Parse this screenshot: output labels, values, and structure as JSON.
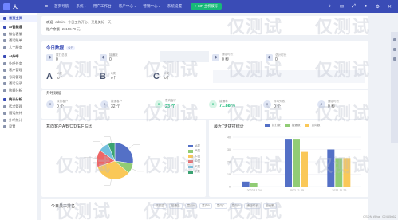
{
  "brand": {
    "name": "人"
  },
  "topnav": [
    {
      "label": "首页导航",
      "drop": false
    },
    {
      "label": "系统",
      "drop": true
    },
    {
      "label": "用户工作台",
      "drop": false
    },
    {
      "label": "客户中心",
      "drop": true
    },
    {
      "label": "营销中心",
      "drop": true
    },
    {
      "label": "系统设置",
      "drop": false
    }
  ],
  "sip_button": "+ SIP 主机拨号",
  "sidebar": [
    {
      "label": "首页主页",
      "type": "item",
      "active": true
    },
    {
      "label": "AI智能通",
      "type": "group"
    },
    {
      "label": "微信客服",
      "type": "item"
    },
    {
      "label": "通话账单",
      "type": "item"
    },
    {
      "label": "人工服务",
      "type": "item"
    },
    {
      "label": "AI外呼",
      "type": "group"
    },
    {
      "label": "外呼任务",
      "type": "item"
    },
    {
      "label": "客户管理",
      "type": "item"
    },
    {
      "label": "号码管理",
      "type": "item"
    },
    {
      "label": "通话记录",
      "type": "item"
    },
    {
      "label": "数据分析",
      "type": "item"
    },
    {
      "label": "统计分析",
      "type": "group"
    },
    {
      "label": "话术管理",
      "type": "item"
    },
    {
      "label": "通话统计",
      "type": "item"
    },
    {
      "label": "外呼统计",
      "type": "item"
    },
    {
      "label": "设置",
      "type": "item"
    }
  ],
  "info": {
    "row1": {
      "label": "欢迎",
      "text": "admin，今日工作开心，又是美好一天"
    },
    "row2": {
      "label": "账户余额",
      "text": "23158.79 元"
    }
  },
  "today": {
    "title": "今日数据",
    "tag": "今日",
    "stats": [
      {
        "icon": "phone-icon",
        "label": "拨打总数",
        "value": "0"
      },
      {
        "icon": "check-icon",
        "label": "接通数",
        "value": "0"
      },
      {
        "icon": "clock-icon",
        "label": "通话时长",
        "value": "0 秒"
      },
      {
        "icon": "calendar-icon",
        "label": "总计时长",
        "value": "0"
      }
    ],
    "levels": [
      {
        "letter": "A",
        "label": "A类",
        "value": "0个"
      },
      {
        "letter": "B",
        "label": "B类",
        "value": "0个"
      },
      {
        "letter": "C",
        "label": "C类",
        "value": "0个"
      }
    ],
    "call_title": "外呼数据"
  },
  "callstats": [
    {
      "icon": "phone-icon",
      "label": "拨打客户",
      "value": "0 个",
      "green": false
    },
    {
      "icon": "user-icon",
      "label": "接通客户",
      "value": "32 个",
      "green": false
    },
    {
      "icon": "user-plus-icon",
      "label": "意向客户",
      "value": "23 个",
      "green": true
    },
    {
      "icon": "percent-icon",
      "label": "接通率",
      "value": "71.88 %",
      "green": true
    },
    {
      "icon": "user-icon",
      "label": "呼叫失败",
      "value": "0 个",
      "green": false
    },
    {
      "icon": "clock-icon",
      "label": "通话时长",
      "value": "0 秒",
      "green": false
    }
  ],
  "customer_chart": {
    "title": "意向客户A/B/C/D/E/F占比",
    "chart_data": {
      "type": "pie",
      "categories": [
        "A类",
        "B类",
        "C类",
        "D类",
        "E类",
        "F类"
      ],
      "values": [
        9,
        3,
        11,
        5,
        3,
        2
      ],
      "colors": [
        "#5470c6",
        "#91cc75",
        "#fac858",
        "#ee6666",
        "#73c0de",
        "#3ba272"
      ]
    }
  },
  "trend_chart": {
    "title": "最近7天拨打统计",
    "chart_data": {
      "type": "bar",
      "categories": [
        "2022-11-24",
        "2022-11-25",
        "2022-11-26"
      ],
      "series": [
        {
          "name": "拨打数",
          "values": [
            4,
            38,
            30
          ],
          "color": "#5470c6"
        },
        {
          "name": "接通数",
          "values": [
            3,
            38,
            23
          ],
          "color": "#91cc75"
        },
        {
          "name": "意向数",
          "values": [
            0,
            28,
            23
          ],
          "color": "#fac858"
        }
      ],
      "ylim": [
        0,
        40
      ],
      "yticks": [
        0,
        10,
        20,
        30,
        40
      ]
    }
  },
  "rank": {
    "title": "今日员工排名",
    "tabs": [
      "拨打量",
      "接通量",
      "意向A",
      "意向B",
      "意向C",
      "意向D",
      "通话时长",
      "接通率"
    ]
  },
  "watermark": "仅测试",
  "credit": "CSDN @hai_02465662"
}
